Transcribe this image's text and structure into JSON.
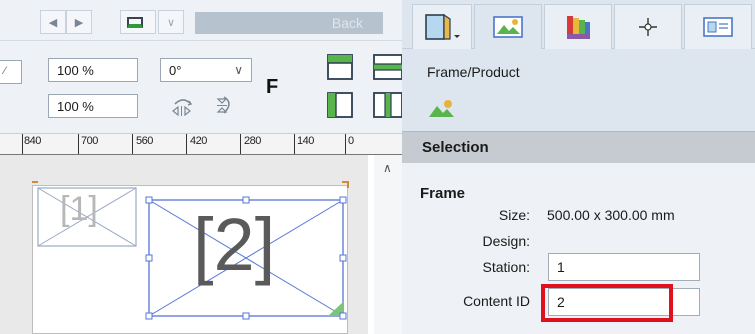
{
  "toolbar": {
    "back_label": "Back",
    "zoom_x": "100 %",
    "zoom_y": "100 %",
    "rotation": "0°",
    "flip_label": "F",
    "nav_prev_icon": "chevron-left-icon",
    "nav_next_icon": "chevron-right-icon"
  },
  "ruler": {
    "labels": [
      "840",
      "700",
      "560",
      "420",
      "280",
      "140",
      "0"
    ]
  },
  "canvas": {
    "frame_1_label": "[1]",
    "frame_2_label": "[2]"
  },
  "panel": {
    "tabs": [
      "frame-product-tab",
      "color-tab",
      "palette-tab",
      "position-tab",
      "layout-tab"
    ],
    "section_title": "Frame/Product",
    "selection_header": "Selection",
    "group_title": "Frame",
    "size_label": "Size:",
    "size_value": "500.00 x 300.00 mm",
    "design_label": "Design:",
    "station_label": "Station:",
    "station_value": "1",
    "content_id_label": "Content ID",
    "content_id_value": "2",
    "highlight_color": "#e0101f"
  }
}
